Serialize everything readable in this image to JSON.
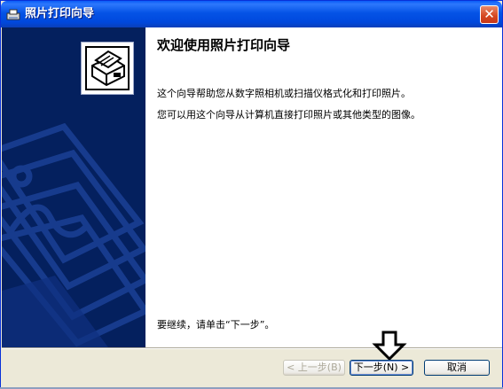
{
  "window": {
    "title": "照片打印向导"
  },
  "content": {
    "heading": "欢迎使用照片打印向导",
    "line1": "这个向导帮助您从数字照相机或扫描仪格式化和打印照片。",
    "line2": "您可以用这个向导从计算机直接打印照片或其他类型的图像。",
    "continue_text": "要继续，请单击“下一步”。"
  },
  "buttons": {
    "back": "< 上一步(B)",
    "next": "下一步(N) >",
    "cancel": "取消"
  },
  "icons": {
    "title": "printer-icon",
    "logo": "photo-printer-icon",
    "close": "close-icon",
    "pointer": "down-arrow-icon"
  },
  "colors": {
    "titlebar": "#0553e6",
    "left_panel": "#04205e",
    "close": "#d4461f",
    "background": "#ece9d8"
  }
}
